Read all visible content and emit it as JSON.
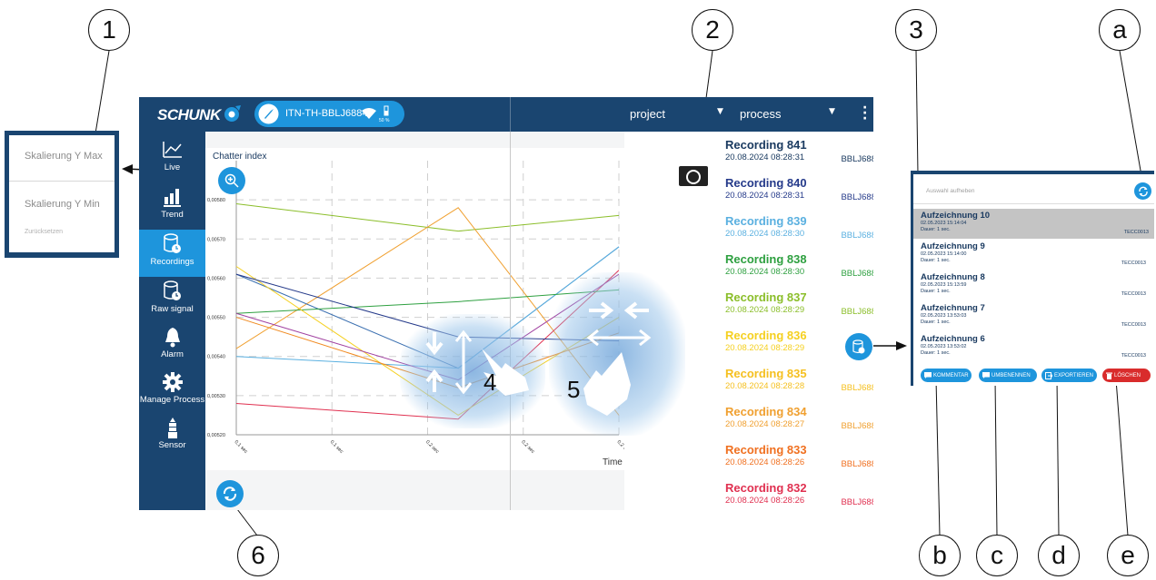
{
  "callouts": [
    "1",
    "2",
    "3",
    "a",
    "4",
    "5",
    "6",
    "b",
    "c",
    "d",
    "e"
  ],
  "topbar": {
    "brand": "SCHUNK",
    "device": "ITN-TH-BBLJ6884",
    "battery": "50 %",
    "project_label": "project",
    "process_label": "process",
    "menu_icon": "more-vertical-icon"
  },
  "sidebar": {
    "items": [
      {
        "label": "Live",
        "icon": "line-chart-icon"
      },
      {
        "label": "Trend",
        "icon": "bar-chart-icon"
      },
      {
        "label": "Recordings",
        "icon": "database-clock-icon",
        "active": true
      },
      {
        "label": "Raw signal",
        "icon": "database-clock-icon"
      },
      {
        "label": "Alarm",
        "icon": "bell-icon"
      },
      {
        "label": "Manage Process",
        "icon": "gear-icon"
      },
      {
        "label": "Sensor",
        "icon": "sensor-icon"
      }
    ]
  },
  "chart_data": {
    "type": "line",
    "title": "Chatter index",
    "xlabel": "Time",
    "x_ticks": [
      "0,1 sec",
      "0,1 sec",
      "0,2 sec",
      "0,2 sec",
      "0,2 sec"
    ],
    "y_ticks": [
      "0,00520",
      "0,00530",
      "0,00540",
      "0,00550",
      "0,00560",
      "0,00570",
      "0,00580"
    ],
    "ylim": [
      0.0052,
      0.0059
    ],
    "grid": true,
    "series": [
      {
        "color": "#8bbe2a",
        "values": [
          0.00579,
          0.00572,
          0.00576
        ]
      },
      {
        "color": "#f0a030",
        "values": [
          0.00542,
          0.00578,
          0.00525
        ]
      },
      {
        "color": "#3a6fb0",
        "values": [
          0.00561,
          0.00537,
          0.00568
        ]
      },
      {
        "color": "#5ab0e0",
        "values": [
          0.0054,
          0.00537,
          0.00568
        ]
      },
      {
        "color": "#e03050",
        "values": [
          0.00528,
          0.00524,
          0.00562
        ]
      },
      {
        "color": "#2ea040",
        "values": [
          0.00551,
          0.00554,
          0.00557
        ]
      },
      {
        "color": "#f5d020",
        "values": [
          0.00563,
          0.00525,
          0.0055
        ]
      },
      {
        "color": "#253a8a",
        "values": [
          0.00561,
          0.00545,
          0.00544
        ]
      },
      {
        "color": "#a040a0",
        "values": [
          0.00551,
          0.00534,
          0.00561
        ]
      },
      {
        "color": "#f08a20",
        "values": [
          0.0055,
          0.00532,
          0.00546
        ]
      }
    ]
  },
  "gestures": {
    "pinch_y_label": "4",
    "pinch_x_label": "5"
  },
  "recordings": [
    {
      "title": "Recording 841",
      "date": "20.08.2024 08:28:31",
      "id": "BBLJ688",
      "color": "#1a3a60"
    },
    {
      "title": "Recording 840",
      "date": "20.08.2024 08:28:31",
      "id": "BBLJ688",
      "color": "#253a8a"
    },
    {
      "title": "Recording 839",
      "date": "20.08.2024 08:28:30",
      "id": "BBLJ688",
      "color": "#5ab0e0"
    },
    {
      "title": "Recording 838",
      "date": "20.08.2024 08:28:30",
      "id": "BBLJ688",
      "color": "#2ea040"
    },
    {
      "title": "Recording 837",
      "date": "20.08.2024 08:28:29",
      "id": "BBLJ688",
      "color": "#8bbe2a"
    },
    {
      "title": "Recording 836",
      "date": "20.08.2024 08:28:29",
      "id": "",
      "color": "#f5d020"
    },
    {
      "title": "Recording 835",
      "date": "20.08.2024 08:28:28",
      "id": "BBLJ688",
      "color": "#f5c020"
    },
    {
      "title": "Recording 834",
      "date": "20.08.2024 08:28:27",
      "id": "BBLJ688",
      "color": "#f0a030"
    },
    {
      "title": "Recording 833",
      "date": "20.08.2024 08:28:26",
      "id": "BBLJ688",
      "color": "#f07020"
    },
    {
      "title": "Recording 832",
      "date": "20.08.2024 08:28:26",
      "id": "BBLJ688",
      "color": "#e03050"
    }
  ],
  "scale_dialog": {
    "y_max": "Skalierung Y Max",
    "y_min": "Skalierung Y Min",
    "reset": "Zurücksetzen"
  },
  "rec_panel": {
    "deselect": "Auswahl aufheben",
    "items": [
      {
        "title": "Aufzeichnung 10",
        "date": "02.05.2023 15:14:04",
        "duration": "Dauer: 1 sec.",
        "code": "TECC0013",
        "selected": true
      },
      {
        "title": "Aufzeichnung 9",
        "date": "02.05.2023 15:14:00",
        "duration": "Dauer: 1 sec.",
        "code": "TECC0013"
      },
      {
        "title": "Aufzeichnung 8",
        "date": "02.05.2023 15:13:59",
        "duration": "Dauer: 1 sec.",
        "code": "TECC0013"
      },
      {
        "title": "Aufzeichnung 7",
        "date": "02.05.2023 13:53:03",
        "duration": "Dauer: 1 sec.",
        "code": "TECC0013"
      },
      {
        "title": "Aufzeichnung 6",
        "date": "02.05.2023 13:53:02",
        "duration": "Dauer: 1 sec.",
        "code": "TECC0013"
      }
    ],
    "buttons": {
      "comment": "KOMMENTAR",
      "rename": "UMBENENNEN",
      "export": "EXPORTIEREN",
      "delete": "LÖSCHEN"
    }
  },
  "colors": {
    "navy": "#1a4570",
    "accent": "#1e95dc",
    "danger": "#d92c2c"
  }
}
